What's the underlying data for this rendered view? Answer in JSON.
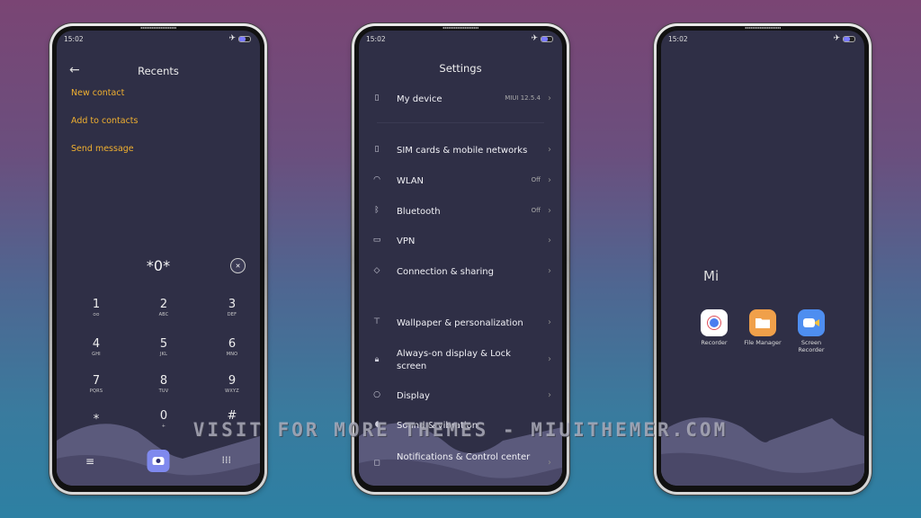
{
  "status_bar": {
    "time": "15:02",
    "airplane_icon": "airplane-icon",
    "battery_icon": "battery-icon",
    "battery_level": 0.55
  },
  "phone_dialer": {
    "title": "Recents",
    "back_icon": "arrow-left-icon",
    "actions": [
      "New contact",
      "Add to contacts",
      "Send message"
    ],
    "display_value": "*0*",
    "delete_icon": "backspace-icon",
    "keys": [
      {
        "num": "1",
        "sub": "voicemail"
      },
      {
        "num": "2",
        "sub": "ABC"
      },
      {
        "num": "3",
        "sub": "DEF"
      },
      {
        "num": "4",
        "sub": "GHI"
      },
      {
        "num": "5",
        "sub": "JKL"
      },
      {
        "num": "6",
        "sub": "MNO"
      },
      {
        "num": "7",
        "sub": "PQRS"
      },
      {
        "num": "8",
        "sub": "TUV"
      },
      {
        "num": "9",
        "sub": "WXYZ"
      },
      {
        "num": "*",
        "sub": ""
      },
      {
        "num": "0",
        "sub": "+"
      },
      {
        "num": "#",
        "sub": ""
      }
    ],
    "bottom_bar": {
      "menu_icon": "menu-icon",
      "call_icon": "phone-icon",
      "dialpad_icon": "dialpad-icon"
    }
  },
  "settings": {
    "title": "Settings",
    "items": [
      {
        "label": "My device",
        "value": "MIUI 12.5.4",
        "icon": "device-icon"
      },
      {
        "label": "SIM cards & mobile networks",
        "value": "",
        "icon": "sim-icon"
      },
      {
        "label": "WLAN",
        "value": "Off",
        "icon": "wifi-icon"
      },
      {
        "label": "Bluetooth",
        "value": "Off",
        "icon": "bluetooth-icon"
      },
      {
        "label": "VPN",
        "value": "",
        "icon": "vpn-icon"
      },
      {
        "label": "Connection & sharing",
        "value": "",
        "icon": "connection-icon"
      },
      {
        "label": "Wallpaper & personalization",
        "value": "",
        "icon": "wallpaper-icon"
      },
      {
        "label": "Always-on display & Lock screen",
        "value": "",
        "icon": "lock-icon"
      },
      {
        "label": "Display",
        "value": "",
        "icon": "display-icon"
      },
      {
        "label": "Sound & vibration",
        "value": "",
        "icon": "sound-icon"
      },
      {
        "label": "Notifications & Control center",
        "value": "",
        "icon": "notifications-icon"
      }
    ]
  },
  "home_folder": {
    "title": "Mi",
    "apps": [
      {
        "name": "Recorder",
        "icon": "recorder-icon",
        "color": "#ffffff"
      },
      {
        "name": "File Manager",
        "icon": "folder-icon",
        "color": "#f0a04a"
      },
      {
        "name": "Screen Recorder",
        "icon": "video-camera-icon",
        "color": "#4e8ef0"
      }
    ]
  },
  "watermark": "VISIT FOR MORE THEMES - MIUITHEMER.COM",
  "colors": {
    "accent_orange": "#f0b030",
    "screen_bg": "#2f2f46",
    "call_button": "#7f89ee"
  }
}
